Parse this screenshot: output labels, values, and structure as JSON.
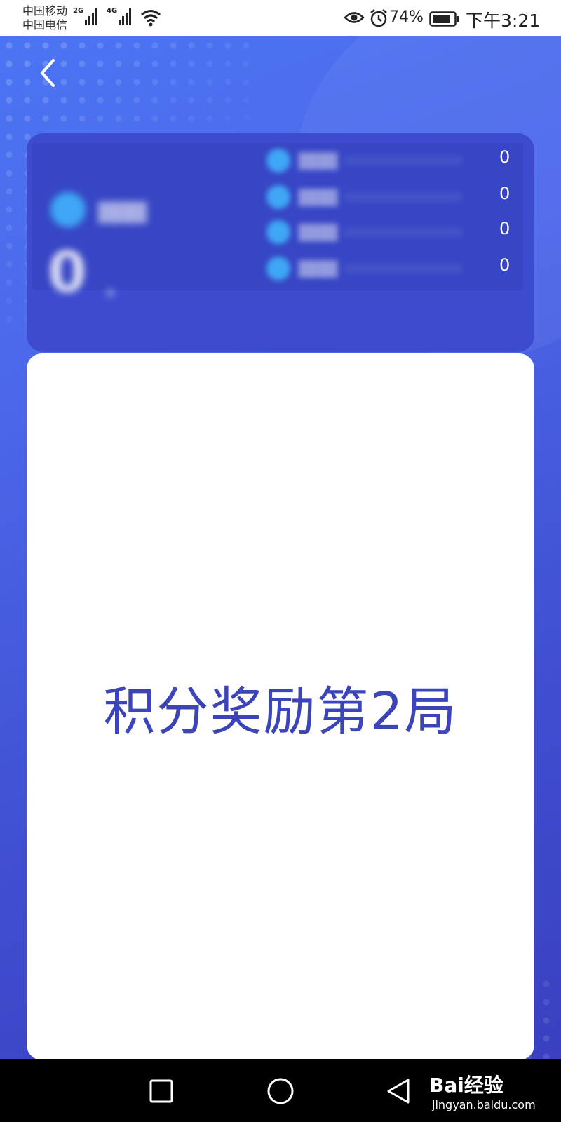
{
  "status_bar": {
    "carrier_1": "中国移动",
    "carrier_2": "中国电信",
    "network_1": "2G",
    "network_2": "4G",
    "battery": "74%",
    "time": "下午3:21"
  },
  "header": {
    "back_icon": "chevron-left-icon"
  },
  "stats": {
    "main_value": "0",
    "rows": [
      {
        "value": "0"
      },
      {
        "value": "0"
      },
      {
        "value": "0"
      },
      {
        "value": "0"
      }
    ]
  },
  "game": {
    "title": "积分奖励第2局"
  },
  "nav": {
    "recent_icon": "square-icon",
    "home_icon": "circle-icon",
    "back_icon": "triangle-back-icon"
  },
  "watermark": {
    "logo": "Bai经验",
    "url": "jingyan.baidu.com"
  },
  "colors": {
    "primary": "#4b6cf0",
    "card_stats": "#3d4ccf",
    "title_text": "#3b44b8",
    "accent_dot": "#3fa7f5"
  }
}
